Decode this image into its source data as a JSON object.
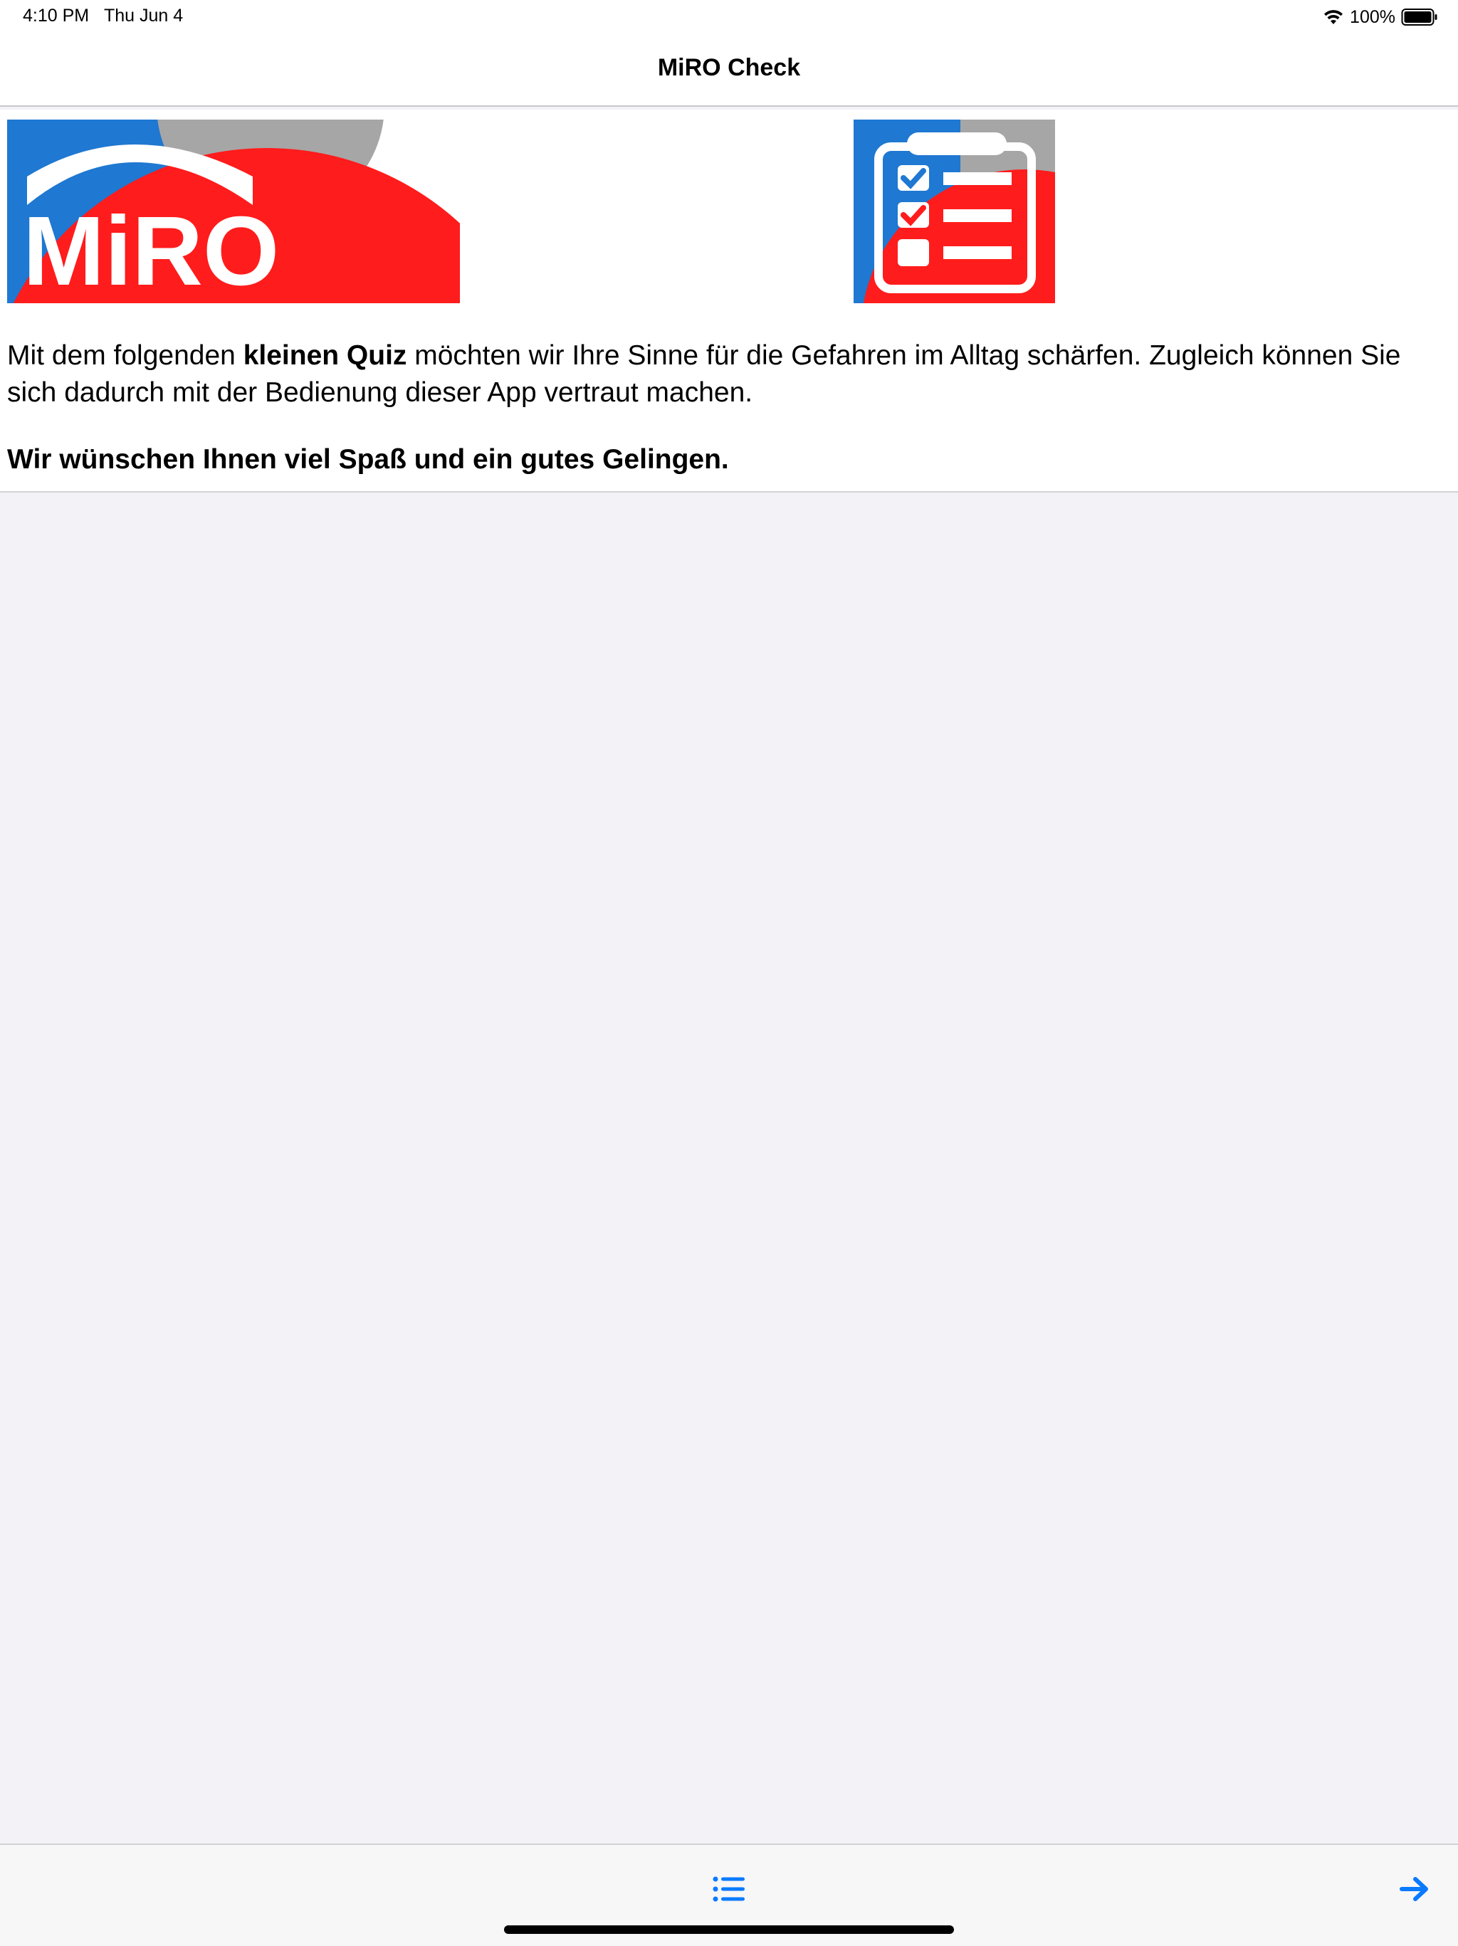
{
  "status_bar": {
    "time": "4:10 PM",
    "date": "Thu Jun 4",
    "battery": "100%"
  },
  "nav": {
    "title": "MiRO Check"
  },
  "logo": {
    "text": "MiRO",
    "colors": {
      "blue": "#1f78d1",
      "red": "#ff1c1c",
      "gray": "#a6a6a6"
    }
  },
  "intro": {
    "part1": "Mit dem folgenden ",
    "bold": "kleinen Quiz",
    "part2": " möchten wir Ihre Sinne für die Gefahren im Alltag schärfen. Zugleich können Sie sich dadurch mit der Bedienung dieser App vertraut machen.",
    "closing": "Wir wünschen Ihnen viel Spaß und ein gutes Gelingen."
  },
  "toolbar": {
    "accent": "#0a7aff",
    "list_icon": "list-icon",
    "next_icon": "arrow-right-icon"
  }
}
